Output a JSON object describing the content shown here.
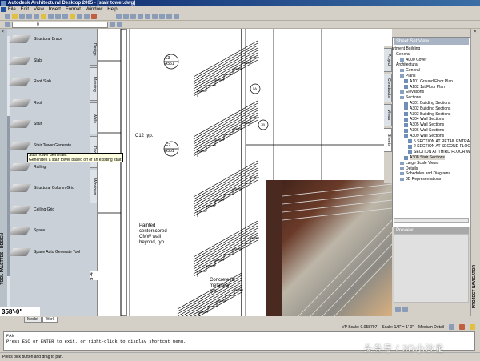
{
  "window": {
    "title": "Autodesk Architectural Desktop 2005 - [stair tower.dwg]"
  },
  "menu": [
    "File",
    "Edit",
    "View",
    "Insert",
    "Format",
    "Window",
    "Help"
  ],
  "layer_value": "0",
  "palette": {
    "title": "TOOL PALETTES - DESIGN",
    "tools": [
      "Structural Brace",
      "Slab",
      "Roof Slab",
      "Roof",
      "Stair",
      "Stair Tower Generate",
      "Railing",
      "Structural Column Grid",
      "Ceiling Grid",
      "Space",
      "Space Auto Generate Tool"
    ],
    "tabs": [
      "Design",
      "Massing",
      "Walls",
      "Doors",
      "Windows"
    ],
    "tooltip": {
      "title": "Stair Tower Generate:",
      "text": "Generates a stair tower based off of an existing stair."
    }
  },
  "drawing": {
    "labels": [
      "C3",
      "A551",
      "E7",
      "A551",
      "C12 typ.",
      "Painted",
      "centerscored",
      "CMW wall",
      "beyond, typ.",
      "Concrete fill",
      "metal pan",
      "typ.",
      "5A",
      "1B",
      "5'-4\""
    ],
    "coordinate": "358'-0\""
  },
  "sheet_set": {
    "title": "Sheet Set View",
    "items": [
      "Apartment Building",
      "General",
      "A000 Cover",
      "Architectural",
      "General",
      "Plans",
      "A101 Ground Floor Plan",
      "A102 1st Floor Plan",
      "Elevations",
      "Sections",
      "A301 Building Sections",
      "A302 Building Sections",
      "A303 Building Sections",
      "A304 Wall Sections",
      "A305 Wall Sections",
      "A306 Wall Sections",
      "A309 Wall Sections",
      "5 SECTION AT RETAIL ENTRAM",
      "2 SECTION AT SECOND FLOOR",
      "SECTION AT THIRD FLOOR W",
      "A308 Stair Sections",
      "Large Scale Views",
      "Details",
      "Schedules and Diagrams",
      "3D Representations"
    ],
    "side_tabs": [
      "Project",
      "Constructs",
      "Views",
      "Sheets"
    ]
  },
  "preview": {
    "title": "Preview"
  },
  "right_strip": {
    "title": "PROJECT NAVIGATOR"
  },
  "layout_tabs": [
    "Model",
    "Work"
  ],
  "status": {
    "vp_scale": "VP Scale: 0.058707",
    "scale": "Scale: 1/8\" = 1'-0\"",
    "detail": "Medium Detail"
  },
  "command": {
    "lines": [
      "PAN",
      "Press ESC or ENTER to exit, or right-click to display shortcut menu."
    ]
  },
  "status_bar": "Press pick button and drag to pan.",
  "watermark": "头条号 / 3D小沙龙"
}
